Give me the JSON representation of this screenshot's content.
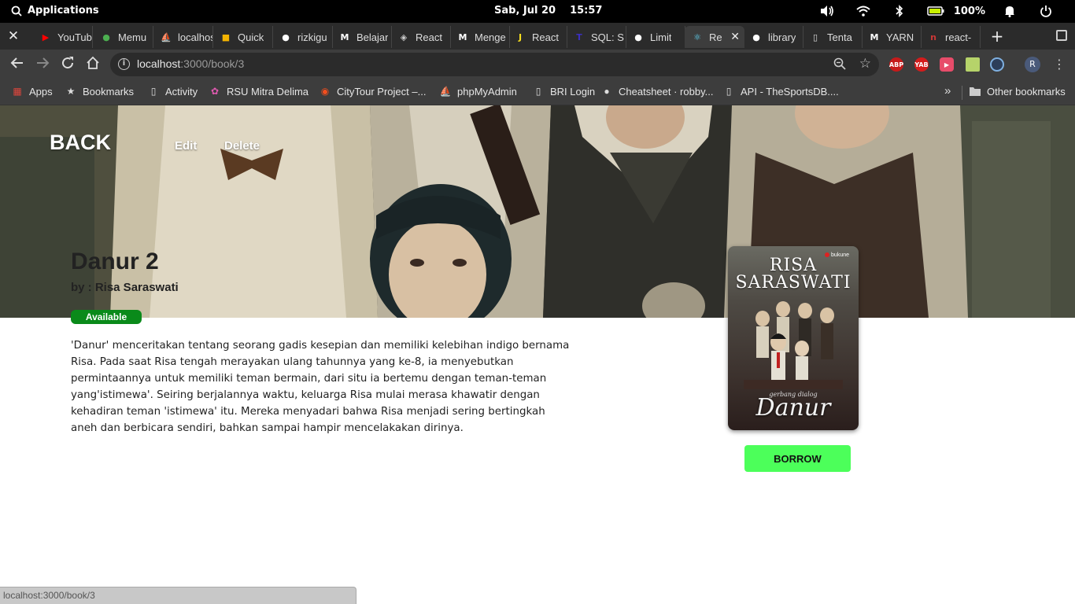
{
  "os": {
    "apps_label": "Applications",
    "date": "Sab, Jul 20",
    "time": "15:57",
    "battery": "100%"
  },
  "tabs": [
    {
      "label": "YouTube",
      "favicon": "youtube-icon",
      "color": "#ff0000"
    },
    {
      "label": "Memu",
      "favicon": "leaf-icon",
      "color": "#4caf50"
    },
    {
      "label": "localhost",
      "favicon": "phpmyadmin-icon",
      "color": "#f0a030"
    },
    {
      "label": "Quick",
      "favicon": "slides-icon",
      "color": "#f4b400"
    },
    {
      "label": "rizkigu",
      "favicon": "github-icon",
      "color": "#ffffff"
    },
    {
      "label": "Belajar",
      "favicon": "medium-icon",
      "color": "#ffffff"
    },
    {
      "label": "React",
      "favicon": "react-diamond-icon",
      "color": "#cccccc"
    },
    {
      "label": "Menge",
      "favicon": "medium-icon",
      "color": "#ffffff"
    },
    {
      "label": "React",
      "favicon": "js-icon",
      "color": "#f7df1e"
    },
    {
      "label": "SQL: S",
      "favicon": "t-icon",
      "color": "#3b2fc0"
    },
    {
      "label": "Limit",
      "favicon": "github-icon",
      "color": "#ffffff"
    },
    {
      "label": "Re",
      "favicon": "react-icon",
      "color": "#61dafb",
      "active": true
    },
    {
      "label": "library",
      "favicon": "github-icon",
      "color": "#ffffff"
    },
    {
      "label": "Tenta",
      "favicon": "doc-icon",
      "color": "#dddddd"
    },
    {
      "label": "YARN",
      "favicon": "medium-icon",
      "color": "#ffffff"
    },
    {
      "label": "react-",
      "favicon": "npm-icon",
      "color": "#cb3837"
    }
  ],
  "address": {
    "host": "localhost",
    "path": ":3000/book/3"
  },
  "bookmarks": [
    {
      "label": "Apps",
      "icon": "apps-grid-icon"
    },
    {
      "label": "Bookmarks",
      "icon": "star-icon"
    },
    {
      "label": "Activity",
      "icon": "doc-icon"
    },
    {
      "label": "RSU Mitra Delima",
      "icon": "flower-icon"
    },
    {
      "label": "CityTour Project –...",
      "icon": "figma-icon"
    },
    {
      "label": "phpMyAdmin",
      "icon": "phpmyadmin-icon"
    },
    {
      "label": "BRI Login",
      "icon": "doc-icon"
    },
    {
      "label": "Cheatsheet · robby...",
      "icon": "github-icon"
    },
    {
      "label": "API - TheSportsDB....",
      "icon": "doc-icon"
    }
  ],
  "other_bookmarks": "Other bookmarks",
  "extensions": {
    "abp": "ABP",
    "yab": "YAB"
  },
  "profile_initial": "R",
  "page": {
    "back_label": "BACK",
    "edit_label": "Edit",
    "delete_label": "Delete",
    "title": "Danur 2",
    "author_line": "by : Risa Saraswati",
    "status": "Available",
    "description": "'Danur' menceritakan tentang seorang gadis kesepian dan memiliki kelebihan indigo bernama Risa. Pada saat Risa tengah merayakan ulang tahunnya yang ke-8, ia menyebutkan permintaannya untuk memiliki teman bermain, dari situ ia bertemu dengan teman-teman yang'istimewa'.   Seiring berjalannya waktu, keluarga Risa mulai merasa khawatir dengan kehadiran teman 'istimewa' itu. Mereka menyadari bahwa Risa menjadi sering bertingkah aneh dan berbicara sendiri, bahkan sampai hampir mencelakakan dirinya.",
    "borrow_label": "BORROW",
    "cover": {
      "author": "RISA SARASWATI",
      "title": "Danur",
      "subtitle": "gerbang dialog",
      "publisher": "bukune"
    }
  },
  "status_bar_url": "localhost:3000/book/3",
  "colors": {
    "available_badge": "#0a8a1a",
    "borrow_button": "#4cff5a"
  }
}
